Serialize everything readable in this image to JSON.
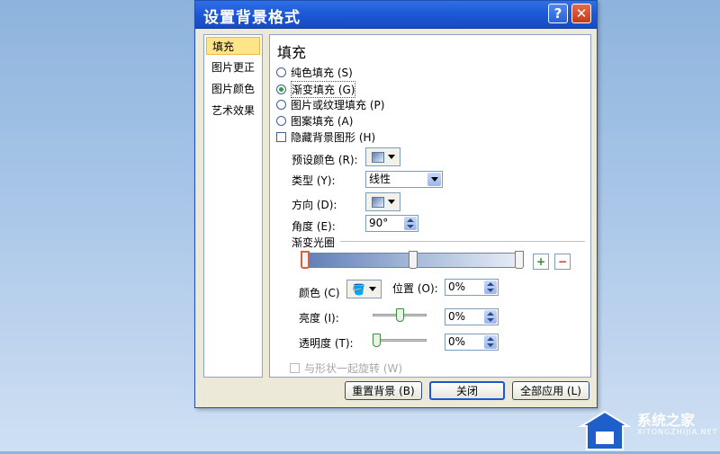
{
  "dialog": {
    "title": "设置背景格式",
    "help_icon": "help-icon",
    "close_icon": "close-icon"
  },
  "nav": {
    "items": [
      {
        "label": "填充",
        "selected": true
      },
      {
        "label": "图片更正",
        "selected": false
      },
      {
        "label": "图片颜色",
        "selected": false
      },
      {
        "label": "艺术效果",
        "selected": false
      }
    ]
  },
  "fill": {
    "heading": "填充",
    "options": [
      {
        "label": "纯色填充 (S)",
        "selected": false
      },
      {
        "label": "渐变填充 (G)",
        "selected": true
      },
      {
        "label": "图片或纹理填充 (P)",
        "selected": false
      },
      {
        "label": "图案填充 (A)",
        "selected": false
      }
    ],
    "hide_background": {
      "label": "隐藏背景图形 (H)",
      "checked": false
    },
    "preset_colors": {
      "label": "预设颜色 (R):"
    },
    "type": {
      "label": "类型 (Y):",
      "value": "线性"
    },
    "direction": {
      "label": "方向 (D):"
    },
    "angle": {
      "label": "角度 (E):",
      "value": "90°"
    },
    "gradient_stops": {
      "label": "渐变光圈"
    },
    "color": {
      "label": "颜色 (C)"
    },
    "position": {
      "label": "位置 (O):",
      "value": "0%"
    },
    "brightness": {
      "label": "亮度 (I):",
      "value": "0%",
      "level": 0.5
    },
    "transparency": {
      "label": "透明度 (T):",
      "value": "0%",
      "level": 0.0
    },
    "rotate_with_shape": {
      "label": "与形状一起旋转 (W)",
      "checked": false,
      "disabled": true
    }
  },
  "buttons": {
    "reset": "重置背景 (B)",
    "close": "关闭",
    "apply_all": "全部应用 (L)"
  },
  "watermark": {
    "name": "系统之家",
    "site": "XITONGZHIJIA.NET"
  },
  "colors": {
    "titlebar": "#1b56d4",
    "selection": "#ffe48a",
    "radio_on": "#2aa23a"
  }
}
